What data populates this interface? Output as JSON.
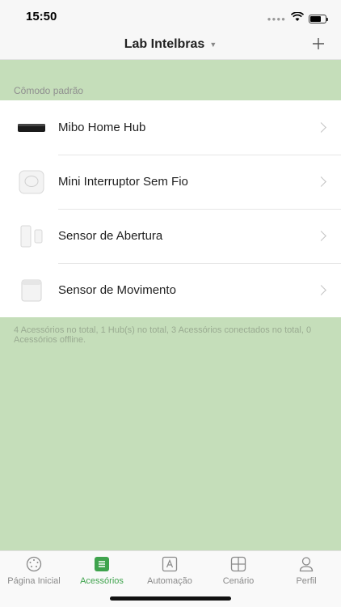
{
  "status": {
    "time": "15:50",
    "signal_icon": "signal-dots-icon",
    "wifi_icon": "wifi-icon",
    "battery_icon": "battery-icon"
  },
  "header": {
    "title": "Lab Intelbras",
    "add_icon": "plus-icon"
  },
  "room": {
    "section_title": "Cômodo padrão",
    "devices": [
      {
        "label": "Mibo Home Hub",
        "icon": "hub-icon"
      },
      {
        "label": "Mini Interruptor Sem Fio",
        "icon": "wireless-switch-icon"
      },
      {
        "label": "Sensor de Abertura",
        "icon": "door-sensor-icon"
      },
      {
        "label": "Sensor de Movimento",
        "icon": "motion-sensor-icon"
      }
    ]
  },
  "summary": "4 Acessórios no total, 1 Hub(s) no total, 3 Acessórios conectados no total, 0 Acessórios offline.",
  "tabs": [
    {
      "label": "Página Inicial",
      "icon": "home-dial-icon",
      "active": false
    },
    {
      "label": "Acessórios",
      "icon": "accessories-list-icon",
      "active": true
    },
    {
      "label": "Automação",
      "icon": "automation-icon",
      "active": false
    },
    {
      "label": "Cenário",
      "icon": "scene-grid-icon",
      "active": false
    },
    {
      "label": "Perfil",
      "icon": "profile-icon",
      "active": false
    }
  ],
  "colors": {
    "background": "#c5deba",
    "accent": "#3fa34d"
  }
}
